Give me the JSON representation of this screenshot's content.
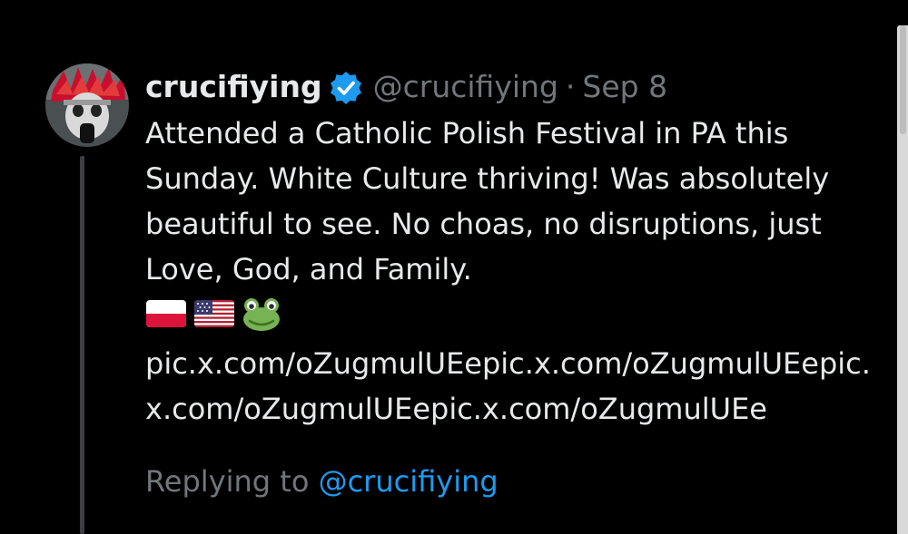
{
  "tweet": {
    "display_name": "crucifiying",
    "handle": "@crucifiying",
    "separator": "·",
    "date": "Sep 8",
    "verified_icon": "verified-badge-icon",
    "text": "Attended a Catholic Polish Festival in PA this Sunday. White Culture thriving! Was absolutely beautiful to see. No choas, no disruptions, just Love, God, and Family.",
    "emojis": [
      "poland-flag-icon",
      "us-flag-icon",
      "frog-icon"
    ],
    "link_text": "pic.x.com/oZugmulUEepic.x.com/oZugmulUEepic.x.com/oZugmulUEepic.x.com/oZugmulUEe"
  },
  "reply": {
    "prefix": "Replying to ",
    "handle": "@crucifiying"
  },
  "colors": {
    "background": "#000000",
    "text": "#e7e9ea",
    "muted": "#71767b",
    "accent": "#1d9bf0"
  }
}
